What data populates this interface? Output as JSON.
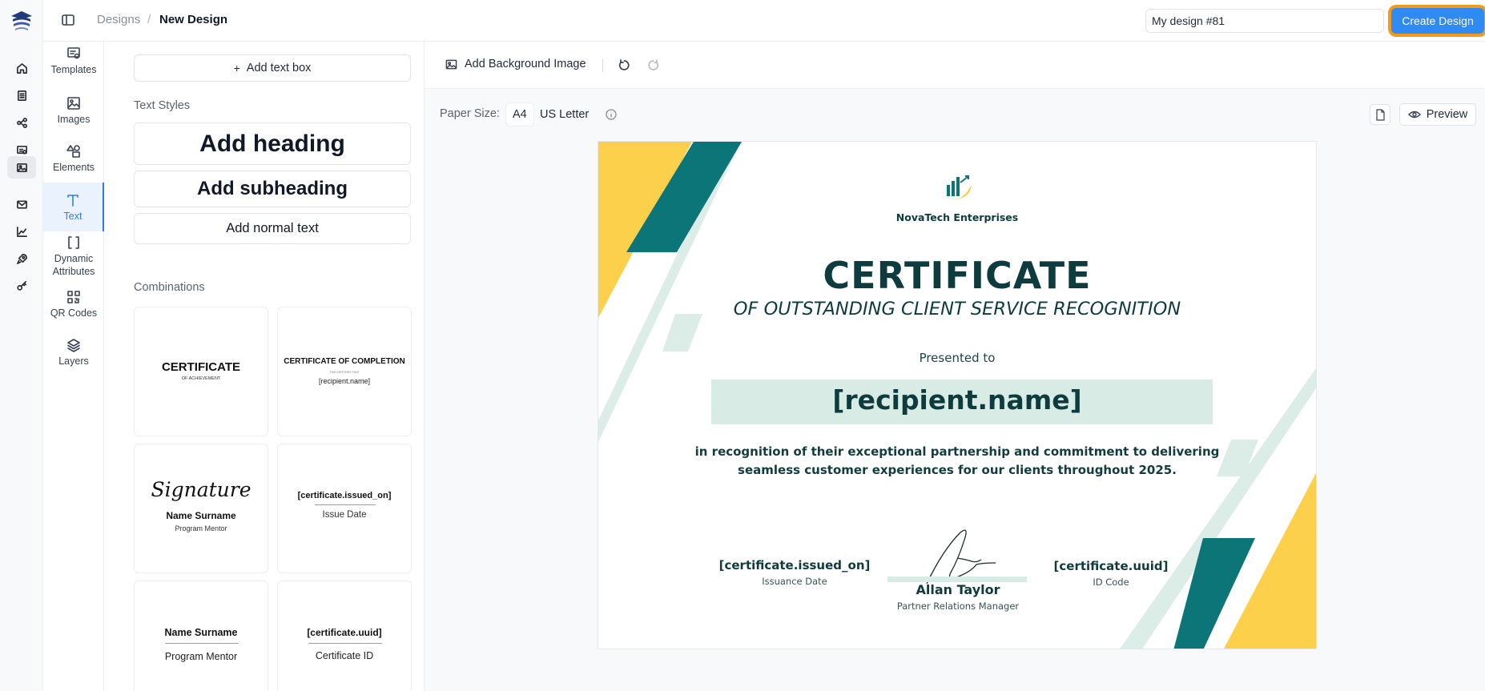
{
  "app": {
    "breadcrumb": {
      "parent": "Designs",
      "separator": "/",
      "current": "New Design"
    },
    "design_name": "My design #81",
    "create_button": "Create Design"
  },
  "rail_icons": [
    "logo",
    "home-icon",
    "document-icon",
    "flow-icon",
    "badge-icon",
    "image-icon",
    "mail-icon",
    "chart-icon",
    "rocket-icon",
    "key-icon"
  ],
  "tools": [
    {
      "label": "Templates",
      "icon": "templates-icon"
    },
    {
      "label": "Images",
      "icon": "images-icon"
    },
    {
      "label": "Elements",
      "icon": "elements-icon"
    },
    {
      "label": "Text",
      "icon": "text-icon",
      "active": true
    },
    {
      "label": "Dynamic Attributes",
      "icon": "brackets-icon"
    },
    {
      "label": "QR Codes",
      "icon": "qr-icon"
    },
    {
      "label": "Layers",
      "icon": "layers-icon"
    }
  ],
  "panel": {
    "add_text_box": "Add text box",
    "text_styles_title": "Text Styles",
    "heading": "Add heading",
    "subheading": "Add subheading",
    "normal": "Add normal text",
    "combinations_title": "Combinations",
    "combos": {
      "c1_title": "CERTIFICATE",
      "c1_sub": "OF ACHIEVEMENT",
      "c2_title": "CERTIFICATE OF COMPLETION",
      "c2_tiny": "THIS CERTIFIES THAT",
      "c2_name": "[recipient.name]",
      "c3_script": "Signature",
      "c3_name": "Name Surname",
      "c3_role": "Program Mentor",
      "c4_attr": "[certificate.issued_on]",
      "c4_label": "Issue Date",
      "c5_name": "Name Surname",
      "c5_role": "Program Mentor",
      "c6_attr": "[certificate.uuid]",
      "c6_label": "Certificate ID"
    }
  },
  "toolbar": {
    "add_background": "Add Background Image",
    "paper_size_label": "Paper Size:",
    "paper_a4": "A4",
    "paper_letter": "US Letter",
    "pdf": "PDF",
    "preview": "Preview"
  },
  "certificate": {
    "company": "NovaTech Enterprises",
    "title": "CERTIFICATE",
    "subtitle": "OF OUTSTANDING CLIENT SERVICE RECOGNITION",
    "presented_to": "Presented to",
    "recipient": "[recipient.name]",
    "body_line1": "in recognition of their exceptional partnership and commitment to delivering",
    "body_line2": "seamless customer experiences for our clients throughout 2025.",
    "issued_attr": "[certificate.issued_on]",
    "issued_label": "Issuance Date",
    "signer_name": "Allan Taylor",
    "signer_role": "Partner Relations Manager",
    "uuid_attr": "[certificate.uuid]",
    "uuid_label": "ID Code"
  },
  "colors": {
    "accent_blue": "#2f8bf3",
    "highlight_orange": "#f39a1c",
    "teal": "#0b7577",
    "yellow": "#fcd04a",
    "mint": "#d8ebe4",
    "dark_teal_text": "#0e3b3d"
  }
}
